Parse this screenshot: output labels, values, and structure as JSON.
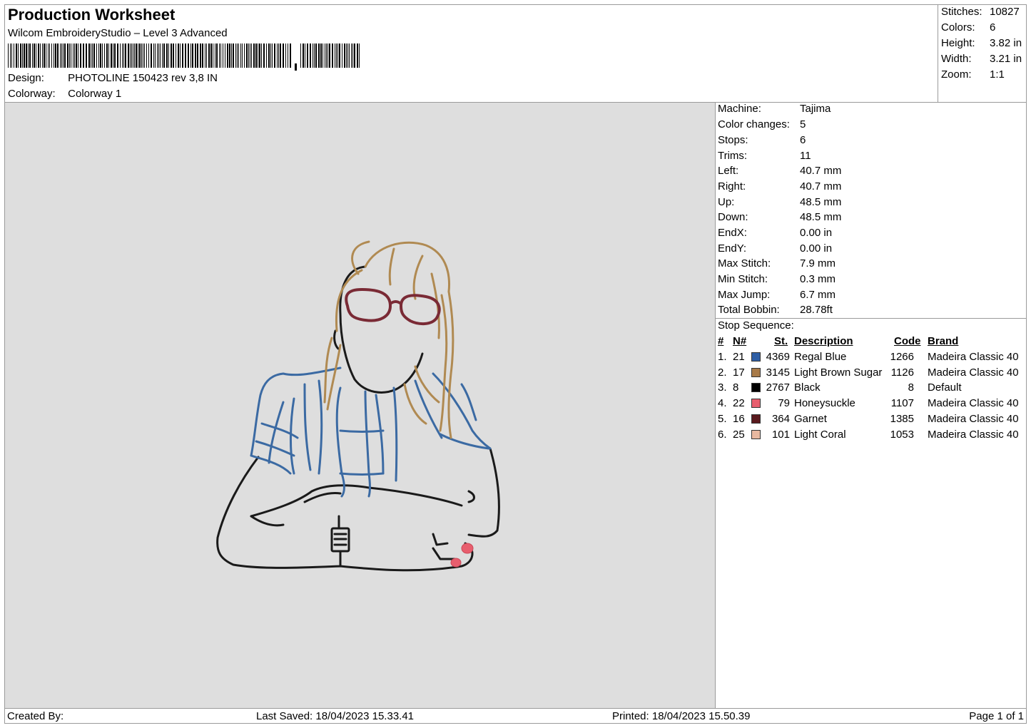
{
  "header": {
    "title": "Production Worksheet",
    "software": "Wilcom EmbroideryStudio – Level 3 Advanced",
    "design_label": "Design:",
    "design_value": "PHOTOLINE 150423 rev 3,8 IN",
    "colorway_label": "Colorway:",
    "colorway_value": "Colorway 1"
  },
  "stats": [
    {
      "label": "Stitches:",
      "value": "10827"
    },
    {
      "label": "Colors:",
      "value": "6"
    },
    {
      "label": "Height:",
      "value": "3.82 in"
    },
    {
      "label": "Width:",
      "value": "3.21 in"
    },
    {
      "label": "Zoom:",
      "value": "1:1"
    }
  ],
  "machine": [
    {
      "label": "Machine:",
      "value": "Tajima"
    },
    {
      "label": "Color changes:",
      "value": "5"
    },
    {
      "label": "Stops:",
      "value": "6"
    },
    {
      "label": "Trims:",
      "value": "11"
    },
    {
      "label": "Left:",
      "value": "40.7 mm"
    },
    {
      "label": "Right:",
      "value": "40.7 mm"
    },
    {
      "label": "Up:",
      "value": "48.5 mm"
    },
    {
      "label": "Down:",
      "value": "48.5 mm"
    },
    {
      "label": "EndX:",
      "value": "0.00 in"
    },
    {
      "label": "EndY:",
      "value": "0.00 in"
    },
    {
      "label": "Max Stitch:",
      "value": "7.9 mm"
    },
    {
      "label": "Min Stitch:",
      "value": "0.3 mm"
    },
    {
      "label": "Max Jump:",
      "value": "6.7 mm"
    },
    {
      "label": "Total Bobbin:",
      "value": "28.78ft"
    }
  ],
  "stop_sequence": {
    "title": "Stop Sequence:",
    "headers": {
      "num": "#",
      "n": "N#",
      "st": "St.",
      "desc": "Description",
      "code": "Code",
      "brand": "Brand"
    },
    "rows": [
      {
        "num": "1.",
        "n": "21",
        "color": "#2f5fa6",
        "st": "4369",
        "desc": "Regal Blue",
        "code": "1266",
        "brand": "Madeira Classic 40"
      },
      {
        "num": "2.",
        "n": "17",
        "color": "#a87a48",
        "st": "3145",
        "desc": "Light Brown Sugar",
        "code": "1126",
        "brand": "Madeira Classic 40"
      },
      {
        "num": "3.",
        "n": "8",
        "color": "#000000",
        "st": "2767",
        "desc": "Black",
        "code": "8",
        "brand": "Default"
      },
      {
        "num": "4.",
        "n": "22",
        "color": "#e85e6e",
        "st": "79",
        "desc": "Honeysuckle",
        "code": "1107",
        "brand": "Madeira Classic 40"
      },
      {
        "num": "5.",
        "n": "16",
        "color": "#5a1a1e",
        "st": "364",
        "desc": "Garnet",
        "code": "1385",
        "brand": "Madeira Classic 40"
      },
      {
        "num": "6.",
        "n": "25",
        "color": "#e8b8a0",
        "st": "101",
        "desc": "Light Coral",
        "code": "1053",
        "brand": "Madeira Classic 40"
      }
    ]
  },
  "footer": {
    "created_by": "Created By:",
    "last_saved": "Last Saved: 18/04/2023 15.33.41",
    "printed": "Printed: 18/04/2023 15.50.39",
    "page": "Page 1 of 1"
  }
}
